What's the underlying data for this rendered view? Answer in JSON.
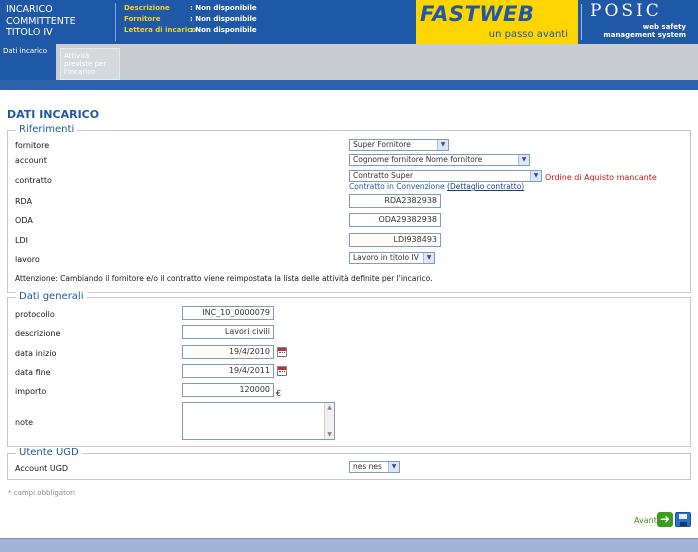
{
  "header": {
    "title": "INCARICO COMMITTENTE TITOLO IV",
    "meta": [
      {
        "label": "Descrizione",
        "value": ": Non disponibile"
      },
      {
        "label": "Fornitore",
        "value": ": Non disponibile"
      },
      {
        "label": "Lettera di incarico",
        "value": ": Non disponibile"
      }
    ],
    "brand_logo": "FASTWEB",
    "brand_tagline": "un passo avanti",
    "product_logo": "POSIC",
    "product_tagline_1": "web safety",
    "product_tagline_2": "management system"
  },
  "tabs": [
    {
      "label": "Dati incarico",
      "active": true
    },
    {
      "label": "Attività previste per l'incarico",
      "active": false
    }
  ],
  "page_title": "DATI INCARICO",
  "riferimenti": {
    "legend": "Riferimenti",
    "fornitore": {
      "label": "fornitore",
      "value": "Super Fornitore"
    },
    "account": {
      "label": "account",
      "value": "Cognome fornitore Nome fornitore"
    },
    "contratto": {
      "label": "contratto",
      "value": "Contratto Super",
      "warning": "Ordine di Aquisto mancante",
      "conv_text": "Contratto in Convenzione",
      "conv_link": "(Dettaglio contratto)"
    },
    "rda": {
      "label": "RDA",
      "value": "RDA2382938"
    },
    "oda": {
      "label": "ODA",
      "value": "ODA29382938"
    },
    "ldi": {
      "label": "LDI",
      "value": "LDI938493"
    },
    "lavoro": {
      "label": "lavoro",
      "value": "Lavoro in titolo IV"
    },
    "attention": "Attenzione: Cambiando il fornitore e/o il contratto viene reimpostata la lista delle attività definite per l'incarico."
  },
  "dati_generali": {
    "legend": "Dati generali",
    "protocollo": {
      "label": "protocollo",
      "value": "INC_10_0000079"
    },
    "descrizione": {
      "label": "descrizione",
      "value": "Lavori civili"
    },
    "data_inizio": {
      "label": "data inizio",
      "value": "19/4/2010"
    },
    "data_fine": {
      "label": "data fine",
      "value": "19/4/2011"
    },
    "importo": {
      "label": "importo",
      "value": "120000",
      "currency": "€"
    },
    "note": {
      "label": "note",
      "value": ""
    }
  },
  "utente_ugd": {
    "legend": "Utente UGD",
    "account": {
      "label": "Account UGD",
      "value": "nes nes"
    }
  },
  "required_note": "* campi obbligatori",
  "actions": {
    "next_label": "Avanti"
  },
  "icons": {
    "dropdown": "chevron-down-icon",
    "calendar": "calendar-icon",
    "next": "arrow-right-icon",
    "save": "floppy-disk-icon"
  },
  "colors": {
    "brand_blue": "#1f58a6",
    "brand_yellow": "#ffd500",
    "warning_red": "#cc1111",
    "next_green": "#3e9c1e"
  }
}
